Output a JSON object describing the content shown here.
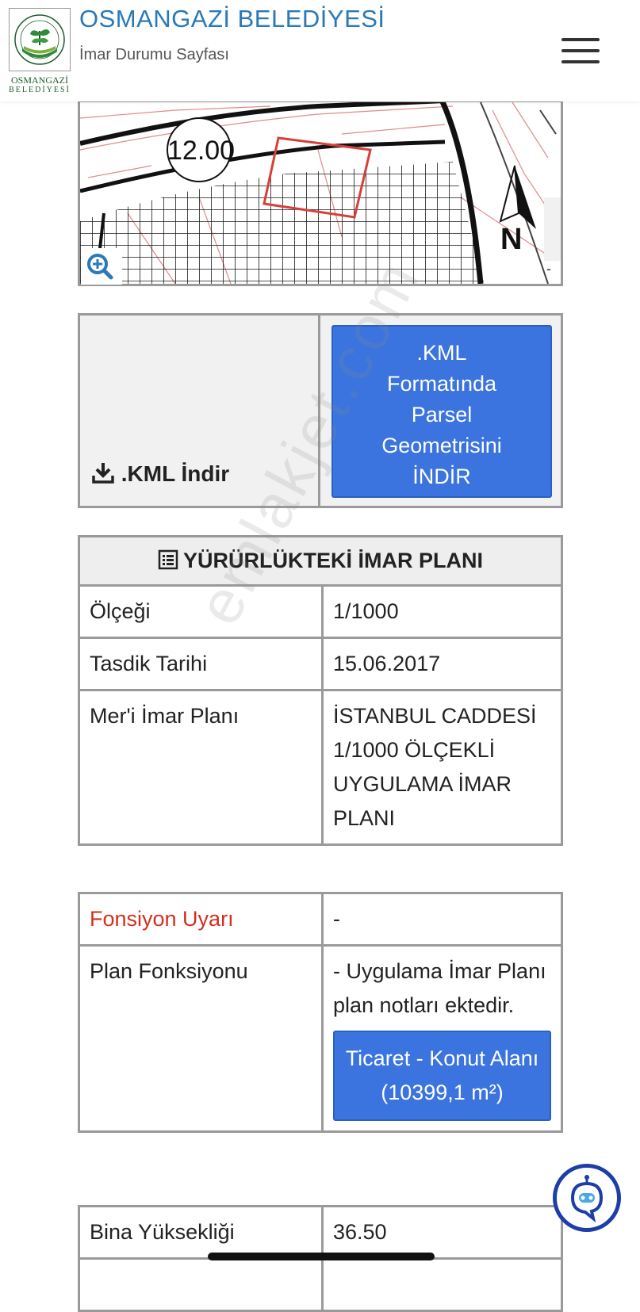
{
  "header": {
    "title": "OSMANGAZİ BELEDİYESİ",
    "subtitle": "İmar Durumu Sayfası",
    "logo_line1": "OSMANGAZİ",
    "logo_line2": "BELEDİYESİ",
    "menu_icon": "hamburger-icon"
  },
  "map": {
    "road_label": "12.00",
    "north_label": "N",
    "zoom_icon": "zoom-in-icon",
    "minus": "-",
    "colors": {
      "grid": "#1a1a1a",
      "parcel": "#d6403a",
      "road": "#111111",
      "plot_lines": "#e08a8a"
    }
  },
  "kml": {
    "download_label": ".KML İndir",
    "download_icon": "download-icon",
    "button_lines": [
      ".KML",
      "Formatında",
      "Parsel",
      "Geometrisini",
      "İNDİR"
    ]
  },
  "plan": {
    "header": "YÜRÜRLÜKTEKİ İMAR PLANI",
    "header_icon": "list-icon",
    "rows": [
      {
        "label": "Ölçeği",
        "value": "1/1000"
      },
      {
        "label": "Tasdik Tarihi",
        "value": "15.06.2017"
      },
      {
        "label": "Mer'i İmar Planı",
        "value": "İSTANBUL CADDESİ 1/1000 ÖLÇEKLİ UYGULAMA İMAR PLANI"
      }
    ]
  },
  "function": {
    "warning_label": "Fonsiyon Uyarı",
    "warning_value": "-",
    "plan_function_label": "Plan Fonksiyonu",
    "plan_function_text": "- Uygulama İmar Planı plan notları ektedir.",
    "plan_function_button": "Ticaret - Konut Alanı (10399,1 m²)"
  },
  "building": {
    "height_label": "Bina Yüksekliği",
    "height_value": "36.50"
  },
  "watermark": "emlakjet.com",
  "chat_icon": "chat-assistant-icon",
  "accent_color": "#3b74de",
  "warning_color": "#d32f1e"
}
